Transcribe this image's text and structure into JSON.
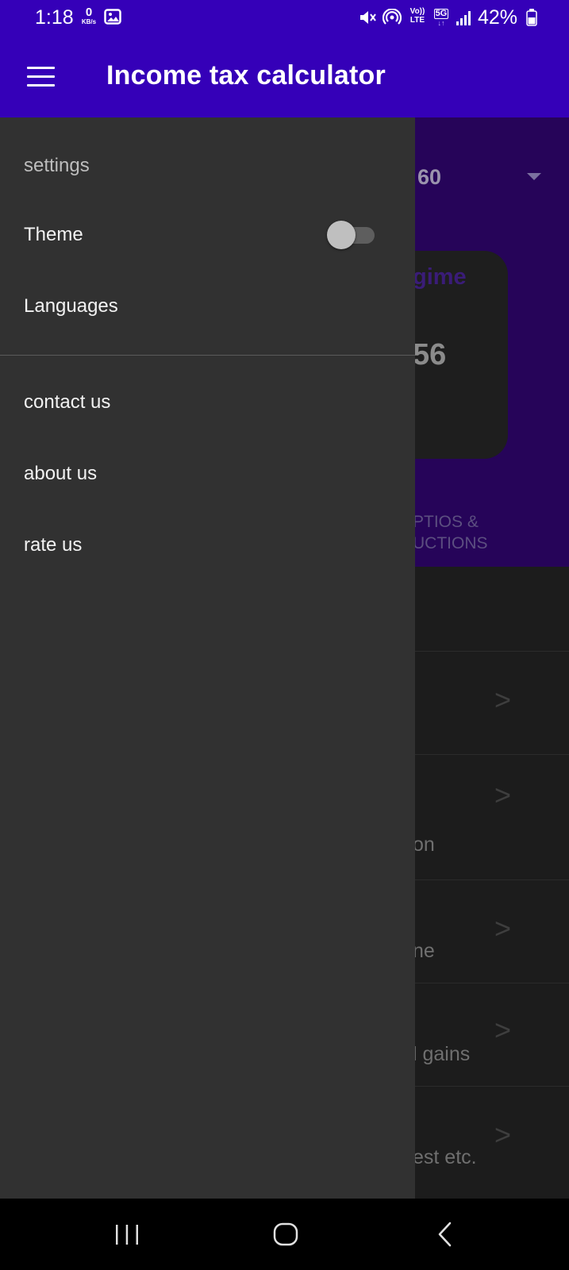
{
  "status_bar": {
    "time": "1:18",
    "data_rate_value": "0",
    "data_rate_unit": "KB/s",
    "network_label_top": "Vo))",
    "network_label_bottom": "LTE",
    "network_5g": "5G",
    "battery_percent": "42%",
    "icons": [
      "gallery-icon",
      "mute-icon",
      "hotspot-icon",
      "signal-icon",
      "battery-icon"
    ]
  },
  "app_bar": {
    "title": "Income tax calculator",
    "icons": [
      "menu-icon"
    ]
  },
  "background": {
    "dropdown_value": "60",
    "card_title_fragment": "gime",
    "card_value_fragment": "56",
    "tab_label_line1": "PTIOS &",
    "tab_label_line2": "UCTIONS",
    "rows": [
      {
        "text": ""
      },
      {
        "text": "on"
      },
      {
        "text": "ne"
      },
      {
        "text": "l gains"
      },
      {
        "text": "est etc."
      }
    ],
    "chevron": ">"
  },
  "drawer": {
    "section_header": "settings",
    "items": [
      {
        "label": "Theme"
      },
      {
        "label": "Languages"
      },
      {
        "label": "contact us"
      },
      {
        "label": "about us"
      },
      {
        "label": "rate us"
      }
    ],
    "theme_toggle_on": false
  },
  "nav_bar": {
    "icons": [
      "recents-icon",
      "home-icon",
      "back-icon"
    ]
  },
  "colors": {
    "app_bar": "#3500b8",
    "drawer": "#313131",
    "hero": "#260459"
  }
}
